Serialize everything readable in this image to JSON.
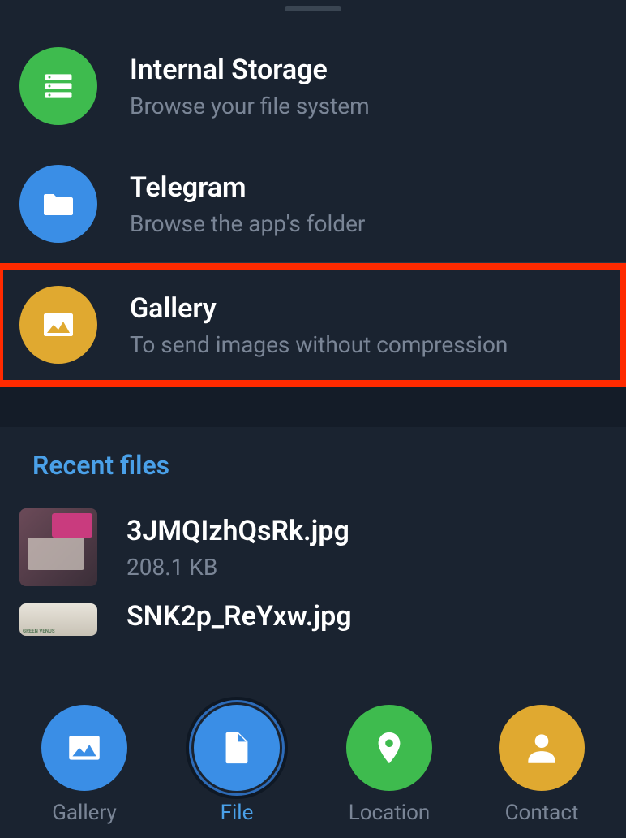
{
  "storage_sources": [
    {
      "title": "Internal Storage",
      "subtitle": "Browse your file system",
      "icon": "storage-icon",
      "color": "green"
    },
    {
      "title": "Telegram",
      "subtitle": "Browse the app's folder",
      "icon": "folder-icon",
      "color": "blue"
    },
    {
      "title": "Gallery",
      "subtitle": "To send images without compression",
      "icon": "image-icon",
      "color": "gold",
      "highlighted": true
    }
  ],
  "recent": {
    "header": "Recent files",
    "files": [
      {
        "name": "3JMQIzhQsRk.jpg",
        "size": "208.1 KB"
      },
      {
        "name": "SNK2p_ReYxw.jpg",
        "size": ""
      }
    ]
  },
  "nav": {
    "items": [
      {
        "label": "Gallery",
        "icon": "image-icon",
        "color": "gallery",
        "active": false
      },
      {
        "label": "File",
        "icon": "file-icon",
        "color": "file",
        "active": true
      },
      {
        "label": "Location",
        "icon": "pin-icon",
        "color": "location",
        "active": false
      },
      {
        "label": "Contact",
        "icon": "person-icon",
        "color": "contact",
        "active": false
      }
    ]
  },
  "thumb2_label": "GREEN VENUS"
}
